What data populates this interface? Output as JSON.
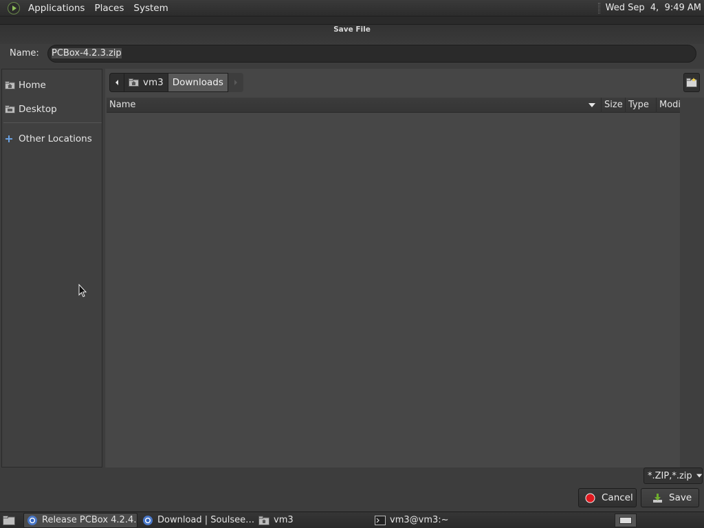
{
  "top_panel": {
    "menus": [
      "Applications",
      "Places",
      "System"
    ],
    "clock": "Wed Sep  4,  9:49 AM"
  },
  "dialog": {
    "title": "Save File",
    "name_label": "Name:",
    "name_value": "PCBox-4.2.3.zip",
    "sidebar": {
      "places": [
        {
          "label": "Home",
          "icon": "home-folder-icon"
        },
        {
          "label": "Desktop",
          "icon": "desktop-folder-icon"
        },
        {
          "label": "Other Locations",
          "icon": "plus-icon"
        }
      ]
    },
    "pathbar": {
      "segments": [
        {
          "label": "vm3",
          "icon": "home-folder-icon",
          "active": false
        },
        {
          "label": "Downloads",
          "active": true
        }
      ]
    },
    "columns": [
      "Name",
      "Size",
      "Type",
      "Modif"
    ],
    "filter": "*.ZIP,*.zip",
    "buttons": {
      "cancel": "Cancel",
      "save": "Save"
    }
  },
  "taskbar": {
    "tasks": [
      {
        "label": "Release PCBox 4.2.4…",
        "icon": "chrome-icon",
        "active": true
      },
      {
        "label": "Download | Soulsee…",
        "icon": "chrome-icon",
        "active": false
      },
      {
        "label": "vm3",
        "icon": "folder-icon",
        "active": false
      },
      {
        "label": "vm3@vm3:~",
        "icon": "terminal-icon",
        "active": false
      }
    ]
  },
  "colors": {
    "panel": "#2e2e2e",
    "dialog": "#3d3d3d",
    "list": "#474747",
    "accent_cancel": "#e0191f",
    "accent_save": "#6fae2e"
  }
}
